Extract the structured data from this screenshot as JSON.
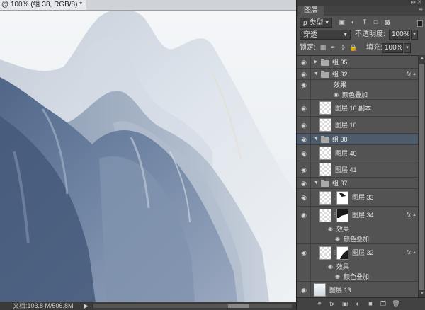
{
  "document": {
    "tab_title": "@ 100% (组 38, RGB/8) *",
    "status_info": "文档:103.8 M/506.8M",
    "play_icon": "play-triangle-icon"
  },
  "panel": {
    "tab_label": "图层",
    "filter_kind": "ρ 类型",
    "blend_mode": "穿透",
    "opacity_label": "不透明度:",
    "opacity_value": "100%",
    "lock_label": "锁定:",
    "fill_label": "填充:",
    "fill_value": "100%",
    "fx_label": "fx"
  },
  "layers": [
    {
      "name": "组 35",
      "type": "group",
      "expanded": false
    },
    {
      "name": "组 32",
      "type": "group",
      "expanded": true,
      "fx": true
    },
    {
      "name": "效果",
      "type": "effects-header"
    },
    {
      "name": "颜色叠加",
      "type": "effect"
    },
    {
      "name": "图层 16 副本",
      "type": "layer"
    },
    {
      "name": "图层 10",
      "type": "layer"
    },
    {
      "name": "组 38",
      "type": "group",
      "expanded": true,
      "selected": true
    },
    {
      "name": "图层 40",
      "type": "layer"
    },
    {
      "name": "图层 41",
      "type": "layer"
    },
    {
      "name": "组 37",
      "type": "group",
      "expanded": true
    },
    {
      "name": "图层 33",
      "type": "layer-mask"
    },
    {
      "name": "图层 34",
      "type": "layer-mask",
      "fx": true
    },
    {
      "name": "效果",
      "type": "effects-header"
    },
    {
      "name": "颜色叠加",
      "type": "effect"
    },
    {
      "name": "图层 32",
      "type": "layer-mask",
      "fx": true
    },
    {
      "name": "效果",
      "type": "effects-header"
    },
    {
      "name": "颜色叠加",
      "type": "effect"
    },
    {
      "name": "图层 13",
      "type": "layer-gradient"
    }
  ],
  "colors": {
    "panel_bg": "#535353",
    "selected_row": "#4e5b6b",
    "mountain_dark": "#5d7393",
    "mountain_light": "#dde4ec"
  }
}
